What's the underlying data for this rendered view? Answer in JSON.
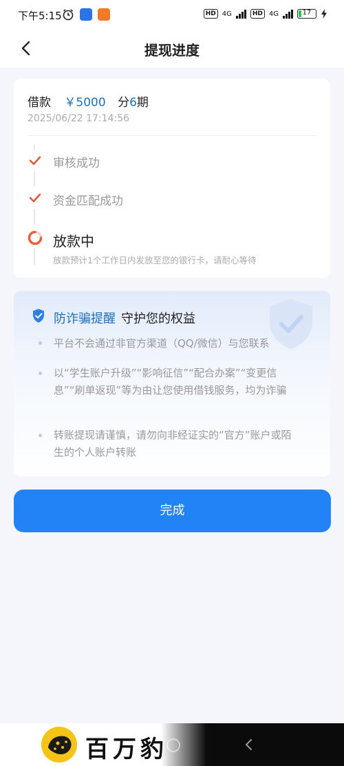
{
  "status": {
    "time": "下午5:15",
    "network1": "4G",
    "network2": "4G",
    "hd1": "HD",
    "hd2": "HD",
    "battery": "17",
    "battery_level": 0.17
  },
  "navbar": {
    "title": "提现进度",
    "back_icon": "chevron-left-icon"
  },
  "loan": {
    "label": "借款",
    "amount": "￥5000",
    "period_prefix": "分",
    "period_num": "6",
    "period_suffix": "期",
    "date": "2025/06/22 17:14:56"
  },
  "progress": {
    "steps": [
      {
        "label": "审核成功",
        "status": "done"
      },
      {
        "label": "资金匹配成功",
        "status": "done"
      }
    ],
    "current": {
      "label": "放款中",
      "desc": "放款预计1个工作日内发放至您的银行卡，请耐心等待"
    }
  },
  "alert": {
    "title_highlight": "防诈骗提醒",
    "title_rest": "守护您的权益",
    "tips": [
      "平台不会通过非官方渠道（QQ/微信）与您联系",
      "以“学生账户升级”“影响征信”“配合办案”“变更信息”“刷单返现”等为由让您使用借钱服务，均为诈骗",
      "转账提现请谨慎，请勿向非经证实的“官方”账户或陌生的个人账户转账"
    ]
  },
  "done_button": "完成",
  "watermark": {
    "brand": "百万豹"
  },
  "colors": {
    "primary": "#2183f6",
    "accent_text": "#1e6fb8",
    "check": "#e05a3a",
    "page_bg": "#f4f6fb"
  }
}
